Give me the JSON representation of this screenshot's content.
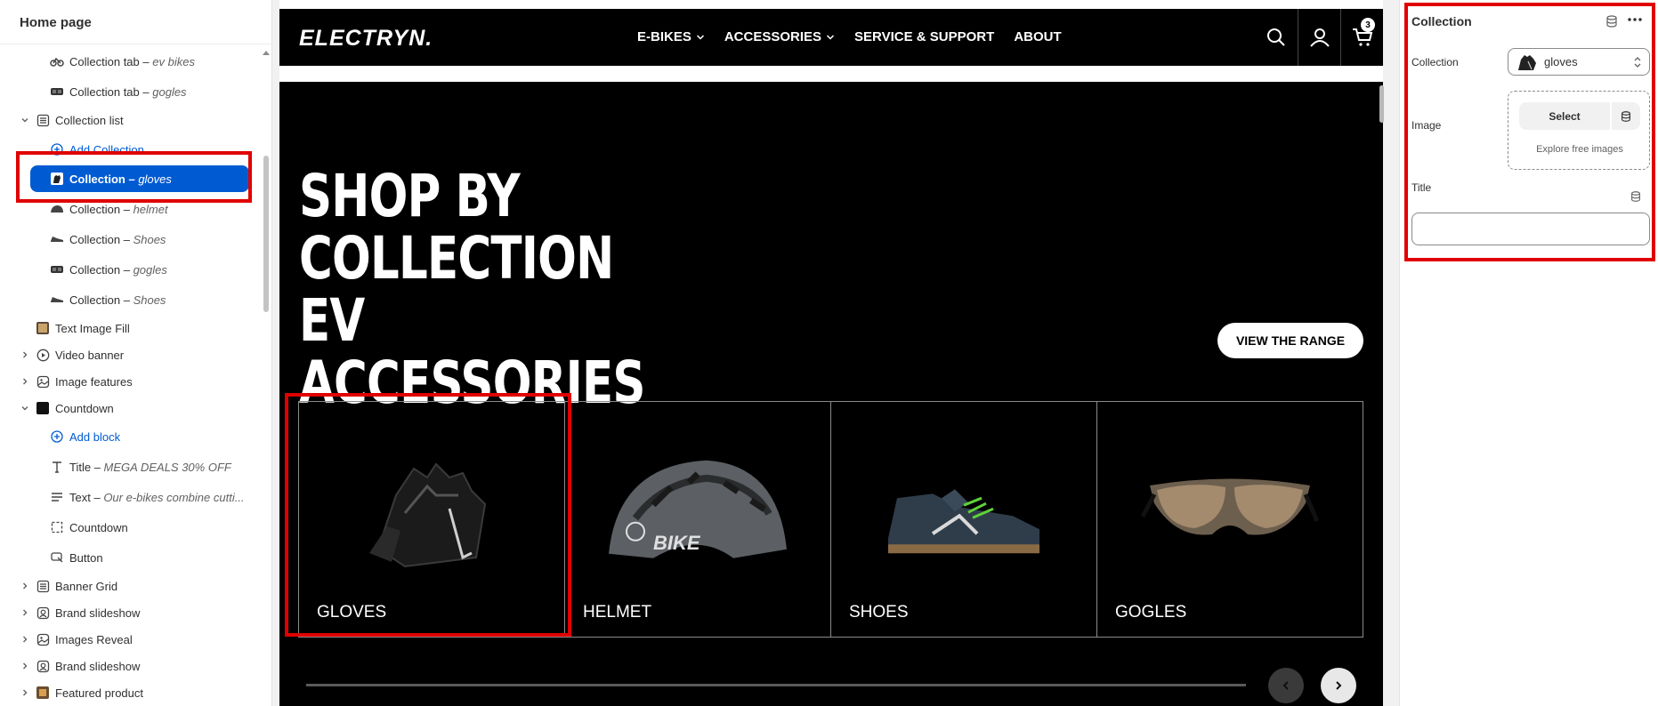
{
  "sidebar": {
    "title": "Home page",
    "items": [
      {
        "label": "Collection tab",
        "sub": "ev bikes"
      },
      {
        "label": "Collection tab",
        "sub": "gogles"
      },
      {
        "label": "Collection list",
        "sub": ""
      },
      {
        "label": "Add Collection",
        "sub": ""
      },
      {
        "label": "Collection",
        "sub": "gloves"
      },
      {
        "label": "Collection",
        "sub": "helmet"
      },
      {
        "label": "Collection",
        "sub": "Shoes"
      },
      {
        "label": "Collection",
        "sub": "gogles"
      },
      {
        "label": "Collection",
        "sub": "Shoes"
      },
      {
        "label": "Text Image Fill",
        "sub": ""
      },
      {
        "label": "Video banner",
        "sub": ""
      },
      {
        "label": "Image features",
        "sub": ""
      },
      {
        "label": "Countdown",
        "sub": ""
      },
      {
        "label": "Add block",
        "sub": ""
      },
      {
        "label": "Title",
        "sub": "MEGA DEALS 30% OFF"
      },
      {
        "label": "Text",
        "sub": "Our e-bikes combine cutti..."
      },
      {
        "label": "Countdown",
        "sub": ""
      },
      {
        "label": "Button",
        "sub": ""
      },
      {
        "label": "Banner Grid",
        "sub": ""
      },
      {
        "label": "Brand slideshow",
        "sub": ""
      },
      {
        "label": "Images Reveal",
        "sub": ""
      },
      {
        "label": "Brand slideshow",
        "sub": ""
      },
      {
        "label": "Featured product",
        "sub": ""
      }
    ],
    "selected_index": 4
  },
  "preview": {
    "logo": "ELECTRYN.",
    "menu": [
      "E-BIKES",
      "ACCESSORIES",
      "SERVICE & SUPPORT",
      "ABOUT"
    ],
    "cart_count": "3",
    "hero_title": "SHOP BY COLLECTION EV ACCESSORIES",
    "range_button": "VIEW THE RANGE",
    "cards": [
      "GLOVES",
      "HELMET",
      "SHOES",
      "GOGLES"
    ]
  },
  "panel": {
    "title": "Collection",
    "collection_label": "Collection",
    "collection_value": "gloves",
    "image_label": "Image",
    "select_button": "Select",
    "explore_link": "Explore free images",
    "title_label": "Title",
    "title_value": ""
  },
  "colors": {
    "accent": "#005bd3",
    "highlight": "#e00000",
    "preview_bg": "#000000"
  }
}
